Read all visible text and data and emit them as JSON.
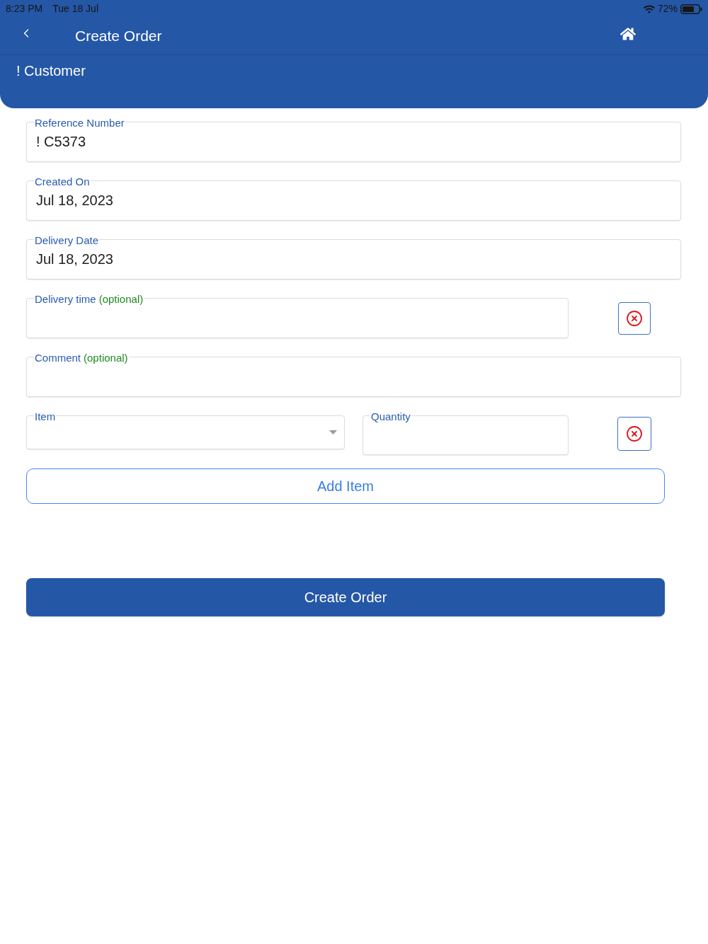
{
  "status_bar": {
    "time": "8:23 PM",
    "date": "Tue 18 Jul",
    "battery": "72%"
  },
  "nav_bar": {
    "title": "Create Order"
  },
  "customer": {
    "name": "! Customer"
  },
  "fields": [
    {
      "kind": "text",
      "label": "Reference Number",
      "value": "! C5373"
    },
    {
      "kind": "text",
      "label": "Created On",
      "value": "Jul 18, 2023"
    },
    {
      "kind": "text",
      "label": "Delivery Date",
      "value": "Jul 18, 2023"
    },
    {
      "kind": "clearable",
      "label": "Delivery time",
      "optional": "(optional)"
    },
    {
      "kind": "text",
      "label": "Comment",
      "optional": "(optional)"
    }
  ],
  "item_row": {
    "item": {
      "label": "Item"
    },
    "quantity": {
      "label": "Quantity"
    }
  },
  "buttons": {
    "add_item": "Add Item",
    "create_order": "Create Order"
  }
}
